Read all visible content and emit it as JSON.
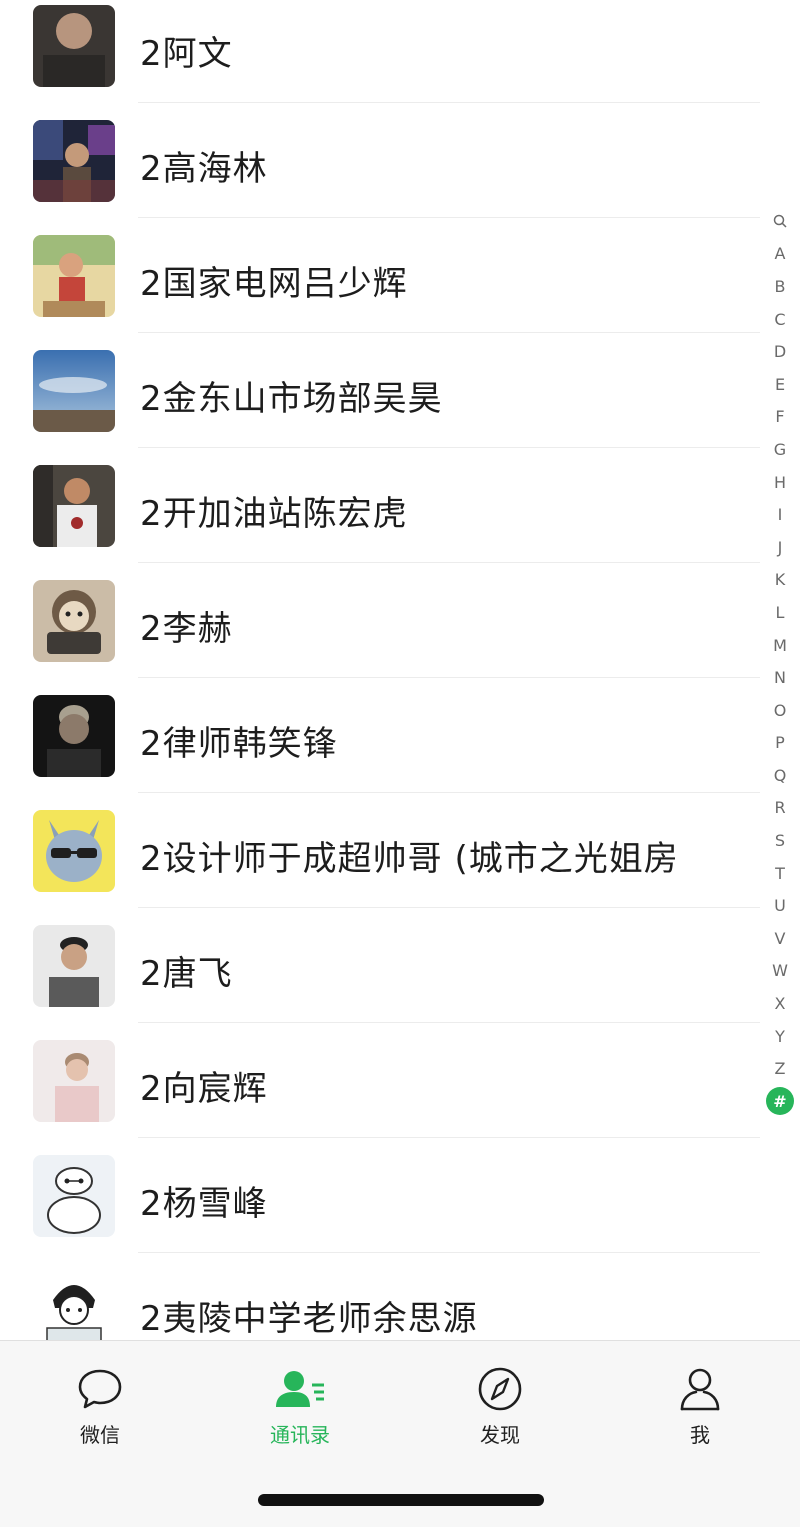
{
  "section_header": "#",
  "contacts": [
    {
      "name": "2阿文",
      "avatar": "man-dark-photo"
    },
    {
      "name": "2高海林",
      "avatar": "night-city-photo"
    },
    {
      "name": "2国家电网吕少辉",
      "avatar": "cartoon-kid"
    },
    {
      "name": "2金东山市场部吴昊",
      "avatar": "sky-landscape"
    },
    {
      "name": "2开加油站陈宏虎",
      "avatar": "man-white-shirt"
    },
    {
      "name": "2李赫",
      "avatar": "monkey-cartoon"
    },
    {
      "name": "2律师韩笑锋",
      "avatar": "man-portrait-dark"
    },
    {
      "name": "2设计师于成超帅哥 (城市之光姐房",
      "avatar": "cat-glasses"
    },
    {
      "name": "2唐飞",
      "avatar": "man-portrait"
    },
    {
      "name": "2向宸辉",
      "avatar": "man-pink-portrait"
    },
    {
      "name": "2杨雪峰",
      "avatar": "baymax"
    },
    {
      "name": "2夷陵中学老师余思源",
      "avatar": "anime-boy"
    }
  ],
  "index_bar": [
    "Q",
    "A",
    "B",
    "C",
    "D",
    "E",
    "F",
    "G",
    "H",
    "I",
    "J",
    "K",
    "L",
    "M",
    "N",
    "O",
    "P",
    "Q",
    "R",
    "S",
    "T",
    "U",
    "V",
    "W",
    "X",
    "Y",
    "Z",
    "#"
  ],
  "tabs": [
    {
      "label": "微信",
      "icon": "chat-bubble-icon"
    },
    {
      "label": "通讯录",
      "icon": "contacts-icon",
      "active": true
    },
    {
      "label": "发现",
      "icon": "compass-icon"
    },
    {
      "label": "我",
      "icon": "person-icon"
    }
  ],
  "colors": {
    "accent": "#27b55a",
    "text": "#1d1d1d",
    "tabbar_bg": "#f7f7f7"
  }
}
